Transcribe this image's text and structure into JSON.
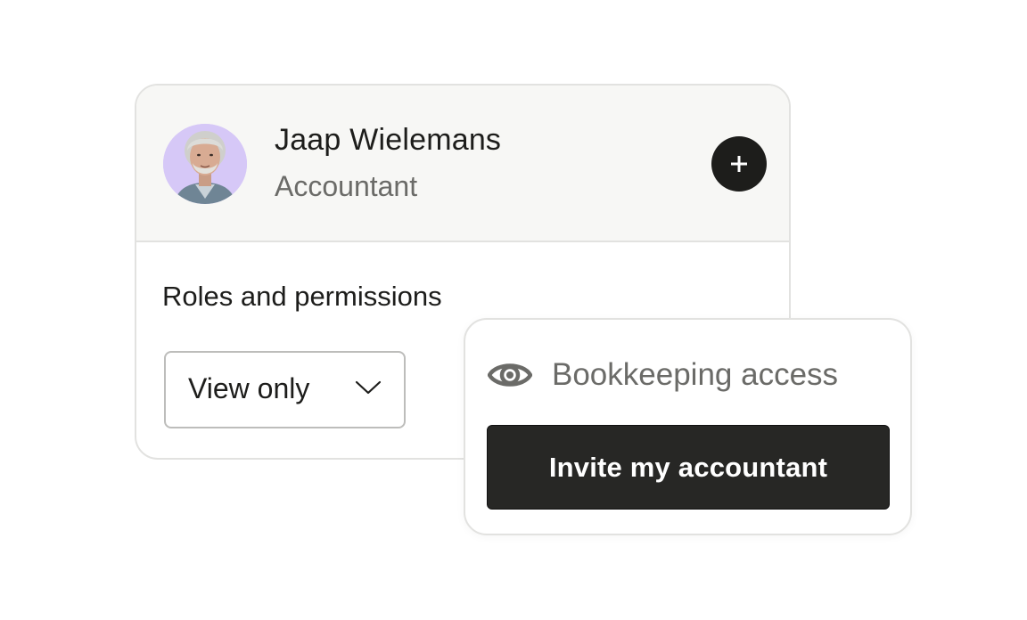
{
  "profile": {
    "name": "Jaap Wielemans",
    "role": "Accountant",
    "avatar_bg": "#d6c8f7",
    "add_icon": "plus-icon"
  },
  "permissions": {
    "section_title": "Roles and permissions",
    "selected": "View only",
    "chevron_icon": "chevron-down-icon"
  },
  "popover": {
    "access_icon": "eye-icon",
    "access_label": "Bookkeeping access",
    "invite_label": "Invite my accountant"
  },
  "colors": {
    "text_primary": "#1d1d1b",
    "text_secondary": "#6b6b68",
    "header_bg": "#f7f7f5",
    "button_bg": "#272725"
  }
}
